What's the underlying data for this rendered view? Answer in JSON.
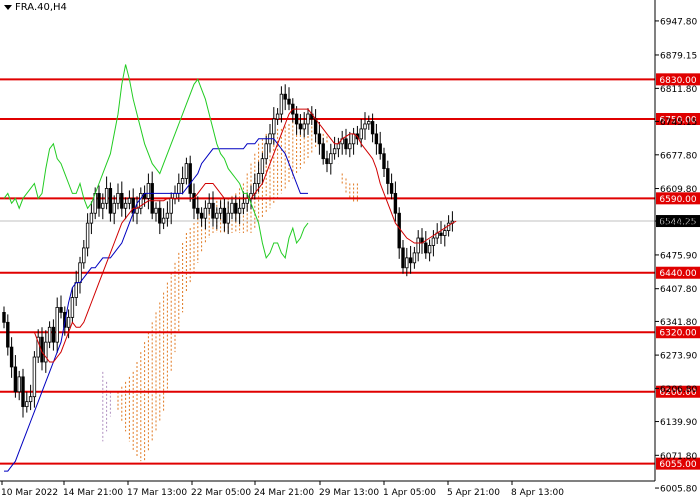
{
  "window": {
    "symbol_label": "FRA.40,H4"
  },
  "colors": {
    "background": "#ffffff",
    "candle": "#000000",
    "level_line": "#e00000",
    "level_label_bg": "#e00000",
    "current_label_bg": "#000000",
    "tenkan": "#d00000",
    "kijun": "#0000c0",
    "chikou": "#22cc22",
    "kumo_bull": "#e07820",
    "kumo_bear": "#b090c0",
    "axis_text": "#000000",
    "current_line": "#c0c0c0"
  },
  "chart_data": {
    "type": "candlestick",
    "title": "FRA.40,H4",
    "timeframe": "H4",
    "ylim": [
      6020,
      6990
    ],
    "y_ticks": [
      "6947.80",
      "6879.15",
      "6811.80",
      "6745.15",
      "6677.80",
      "6609.80",
      "6544.25",
      "6475.90",
      "6407.80",
      "6341.80",
      "6273.90",
      "6206.80",
      "6139.90",
      "6071.80",
      "6005.80"
    ],
    "y_tick_values": [
      6947.8,
      6879.15,
      6811.8,
      6745.15,
      6677.8,
      6609.8,
      6544.25,
      6475.9,
      6407.8,
      6341.8,
      6273.9,
      6206.8,
      6139.9,
      6071.8,
      6005.8
    ],
    "x_ticks": [
      "10 Mar 2022",
      "14 Mar 21:00",
      "17 Mar 13:00",
      "22 Mar 05:00",
      "24 Mar 21:00",
      "29 Mar 13:00",
      "1 Apr 05:00",
      "5 Apr 21:00",
      "8 Apr 13:00"
    ],
    "x_tick_bar_index": [
      0,
      16,
      32,
      48,
      64,
      80,
      96,
      112,
      128
    ],
    "current_price": 6544.25,
    "current_price_label": "6544.25",
    "levels": [
      {
        "value": 6830.0,
        "label": "6830.00"
      },
      {
        "value": 6750.0,
        "label": "6750.00"
      },
      {
        "value": 6590.0,
        "label": "6590.00"
      },
      {
        "value": 6440.0,
        "label": "6440.00"
      },
      {
        "value": 6320.0,
        "label": "6320.00"
      },
      {
        "value": 6200.0,
        "label": "6200.00"
      },
      {
        "value": 6055.0,
        "label": "6055.00"
      }
    ],
    "close": [
      6340,
      6290,
      6250,
      6200,
      6230,
      6170,
      6180,
      6190,
      6270,
      6310,
      6260,
      6300,
      6330,
      6300,
      6370,
      6360,
      6330,
      6350,
      6390,
      6420,
      6460,
      6490,
      6540,
      6560,
      6600,
      6570,
      6580,
      6610,
      6560,
      6580,
      6600,
      6570,
      6580,
      6590,
      6560,
      6570,
      6600,
      6590,
      6620,
      6560,
      6570,
      6540,
      6550,
      6560,
      6590,
      6600,
      6620,
      6630,
      6660,
      6600,
      6570,
      6560,
      6550,
      6570,
      6580,
      6550,
      6560,
      6570,
      6540,
      6560,
      6580,
      6560,
      6570,
      6580,
      6590,
      6600,
      6620,
      6640,
      6670,
      6700,
      6720,
      6750,
      6760,
      6800,
      6790,
      6780,
      6760,
      6740,
      6730,
      6740,
      6760,
      6750,
      6720,
      6700,
      6670,
      6660,
      6680,
      6690,
      6700,
      6710,
      6690,
      6700,
      6720,
      6710,
      6730,
      6740,
      6745,
      6720,
      6700,
      6680,
      6650,
      6620,
      6600,
      6560,
      6490,
      6450,
      6470,
      6460,
      6480,
      6510,
      6500,
      6480,
      6495,
      6510,
      6520,
      6515,
      6525,
      6540,
      6544
    ]
  },
  "indicators": {
    "tenkan": [
      6320,
      6300,
      6280,
      6270,
      6260,
      6260,
      6270,
      6280,
      6300,
      6320,
      6340,
      6330,
      6330,
      6340,
      6360,
      6380,
      6400,
      6420,
      6440,
      6460,
      6480,
      6500,
      6520,
      6540,
      6550,
      6560,
      6570,
      6570,
      6575,
      6580,
      6585,
      6585,
      6585,
      6585,
      6585,
      6590,
      6590,
      6590,
      6590,
      6590,
      6590,
      6590,
      6590,
      6600,
      6610,
      6620,
      6620,
      6620,
      6610,
      6600,
      6590,
      6590,
      6590,
      6590,
      6590,
      6590,
      6590,
      6590,
      6600,
      6610,
      6620,
      6640,
      6660,
      6680,
      6700,
      6720,
      6740,
      6760,
      6770,
      6770,
      6770,
      6770,
      6770,
      6760,
      6750,
      6740,
      6730,
      6720,
      6710,
      6700,
      6700,
      6710,
      6715,
      6720,
      6720,
      6715,
      6700,
      6690,
      6680,
      6670,
      6650,
      6620,
      6600,
      6580,
      6560,
      6540,
      6530,
      6520,
      6510,
      6505,
      6500,
      6500,
      6500,
      6505,
      6510,
      6515,
      6520,
      6525,
      6530,
      6535,
      6540,
      6544
    ],
    "kijun": [
      6040,
      6040,
      6050,
      6060,
      6080,
      6100,
      6120,
      6140,
      6160,
      6180,
      6200,
      6220,
      6240,
      6260,
      6280,
      6300,
      6340,
      6380,
      6410,
      6420,
      6420,
      6430,
      6440,
      6450,
      6450,
      6460,
      6470,
      6470,
      6470,
      6480,
      6490,
      6500,
      6520,
      6540,
      6560,
      6580,
      6590,
      6600,
      6600,
      6600,
      6600,
      6600,
      6600,
      6600,
      6600,
      6600,
      6600,
      6600,
      6610,
      6620,
      6630,
      6640,
      6660,
      6670,
      6680,
      6690,
      6690,
      6690,
      6690,
      6690,
      6690,
      6690,
      6690,
      6690,
      6700,
      6700,
      6700,
      6710,
      6710,
      6710,
      6710,
      6710,
      6700,
      6690,
      6680,
      6660,
      6640,
      6620,
      6600,
      6600,
      6600
    ],
    "chikou": [
      6590,
      6600,
      6580,
      6590,
      6570,
      6590,
      6600,
      6610,
      6620,
      6590,
      6600,
      6650,
      6690,
      6700,
      6670,
      6660,
      6640,
      6620,
      6600,
      6600,
      6620,
      6590,
      6570,
      6580,
      6600,
      6620,
      6640,
      6660,
      6680,
      6720,
      6760,
      6820,
      6860,
      6830,
      6790,
      6760,
      6730,
      6700,
      6680,
      6660,
      6650,
      6640,
      6660,
      6680,
      6700,
      6720,
      6740,
      6760,
      6780,
      6800,
      6820,
      6830,
      6810,
      6790,
      6760,
      6730,
      6700,
      6680,
      6670,
      6650,
      6640,
      6630,
      6620,
      6600,
      6600,
      6580,
      6560,
      6540,
      6500,
      6470,
      6480,
      6500,
      6500,
      6480,
      6470,
      6510,
      6530,
      6500,
      6510,
      6530,
      6540
    ],
    "senkou_a": [
      6100,
      6120,
      6150,
      6180,
      6200,
      6210,
      6220,
      6230,
      6240,
      6260,
      6280,
      6300,
      6320,
      6340,
      6360,
      6380,
      6400,
      6420,
      6440,
      6460,
      6480,
      6500,
      6520,
      6530,
      6540,
      6550,
      6560,
      6570,
      6575,
      6580,
      6585,
      6590,
      6590,
      6590,
      6595,
      6600,
      6610,
      6620,
      6640,
      6660,
      6680,
      6700,
      6710,
      6720,
      6725,
      6730,
      6730,
      6730,
      6735,
      6740,
      6745,
      6750,
      6750,
      6745,
      6740,
      6735,
      6730,
      6725,
      6720,
      6715,
      6700,
      6680,
      6660,
      6640,
      6630,
      6620,
      6620,
      6620
    ],
    "senkou_b": [
      6240,
      6220,
      6200,
      6180,
      6160,
      6140,
      6120,
      6100,
      6080,
      6070,
      6060,
      6060,
      6080,
      6100,
      6120,
      6140,
      6160,
      6200,
      6240,
      6280,
      6320,
      6360,
      6400,
      6420,
      6440,
      6460,
      6480,
      6500,
      6510,
      6520,
      6520,
      6520,
      6520,
      6520,
      6520,
      6520,
      6520,
      6520,
      6520,
      6520,
      6530,
      6540,
      6550,
      6560,
      6570,
      6580,
      6590,
      6600,
      6610,
      6620,
      6630,
      6640,
      6650,
      6660,
      6670,
      6680,
      6690,
      6695,
      6700,
      6700,
      6700,
      6700,
      6660,
      6620,
      6600,
      6590,
      6580,
      6580
    ]
  }
}
